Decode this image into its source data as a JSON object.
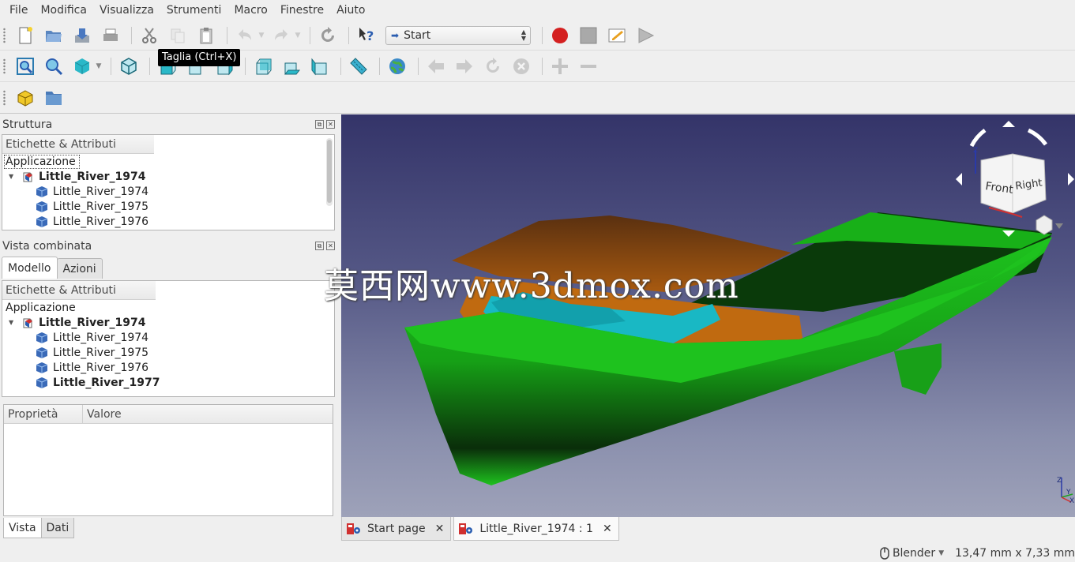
{
  "menu": [
    "File",
    "Modifica",
    "Visualizza",
    "Strumenti",
    "Macro",
    "Finestre",
    "Aiuto"
  ],
  "workbench_selector": {
    "value": "Start"
  },
  "tooltip": "Taglia (Ctrl+X)",
  "colors": {
    "record": "#d42020",
    "hull": "#1ec21e",
    "roof": "#8a4a10",
    "glass": "#19b8c4"
  },
  "structure_panel": {
    "title": "Struttura",
    "header": "Etichette & Attributi",
    "root_label": "Applicazione",
    "document": "Little_River_1974",
    "objects": [
      "Little_River_1974",
      "Little_River_1975",
      "Little_River_1976"
    ]
  },
  "combo_panel": {
    "title": "Vista combinata",
    "tabs": [
      "Modello",
      "Azioni"
    ],
    "header": "Etichette & Attributi",
    "root_label": "Applicazione",
    "document": "Little_River_1974",
    "objects": [
      "Little_River_1974",
      "Little_River_1975",
      "Little_River_1976",
      "Little_River_1977"
    ],
    "property_headers": [
      "Proprietà",
      "Valore"
    ],
    "bottom_tabs": [
      "Vista",
      "Dati"
    ]
  },
  "nav_cube": {
    "front": "Front",
    "right": "Right"
  },
  "axis": {
    "z": "Z",
    "y": "Y",
    "x": "X"
  },
  "watermark": "莫西网www.3dmox.com",
  "doc_tabs": [
    {
      "label": "Start page"
    },
    {
      "label": "Little_River_1974 : 1"
    }
  ],
  "status": {
    "nav_style": "Blender",
    "dimensions": "13,47 mm x 7,33 mm"
  }
}
